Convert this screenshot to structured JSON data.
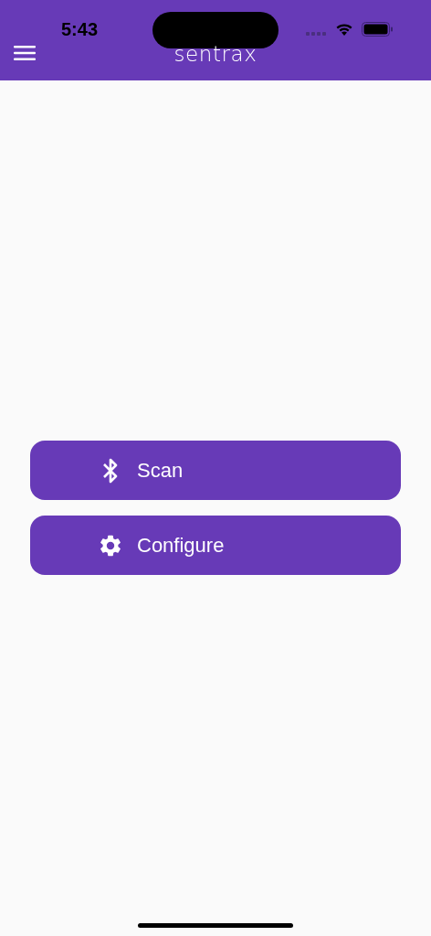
{
  "status_bar": {
    "time": "5:43"
  },
  "app_bar": {
    "logo": "sentrax"
  },
  "buttons": [
    {
      "label": "Scan",
      "kind": "scan"
    },
    {
      "label": "Configure",
      "kind": "configure"
    }
  ]
}
